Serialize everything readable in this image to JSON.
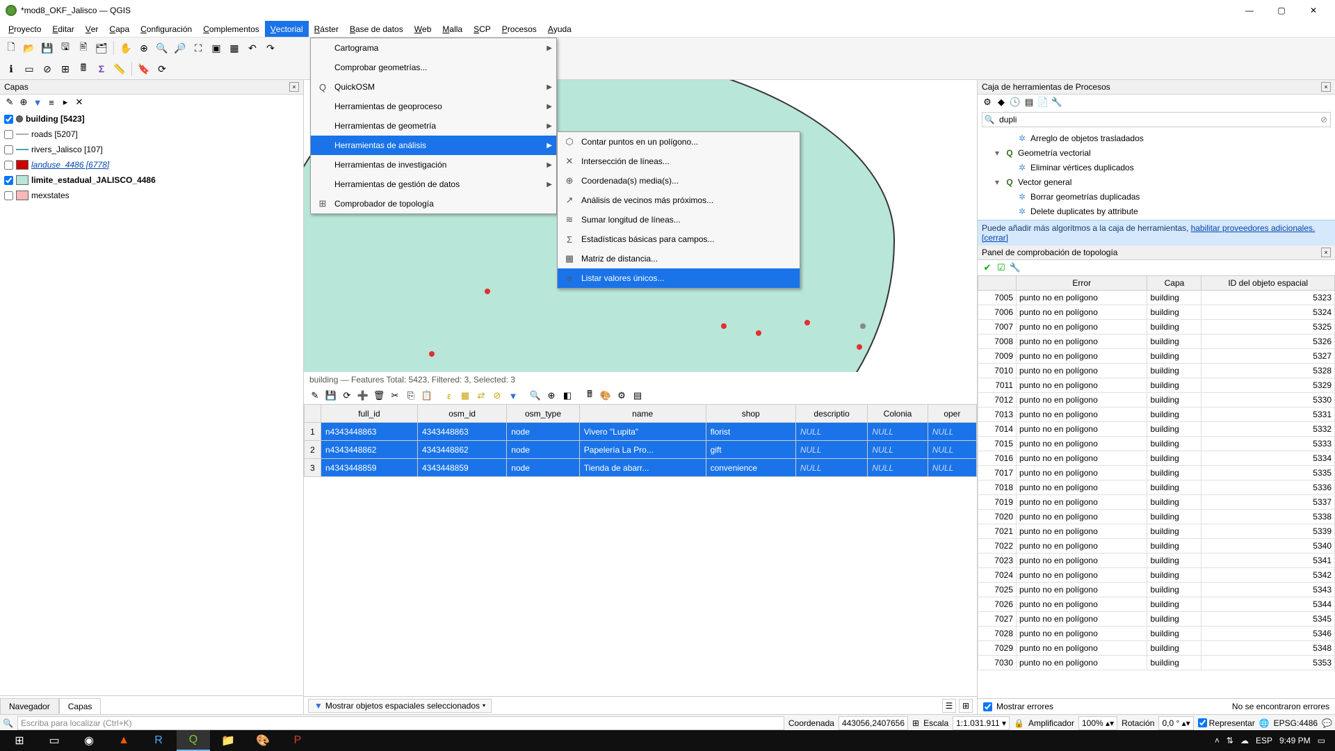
{
  "titlebar": {
    "title": "*mod8_OKF_Jalisco — QGIS"
  },
  "menubar": [
    "Proyecto",
    "Editar",
    "Ver",
    "Capa",
    "Configuración",
    "Complementos",
    "Vectorial",
    "Ráster",
    "Base de datos",
    "Web",
    "Malla",
    "SCP",
    "Procesos",
    "Ayuda"
  ],
  "menubar_active_index": 6,
  "vector_menu": [
    {
      "label": "Cartograma",
      "sub": true,
      "icon": ""
    },
    {
      "label": "Comprobar geometrías...",
      "icon": ""
    },
    {
      "label": "QuickOSM",
      "sub": true,
      "icon": "Q"
    },
    {
      "label": "Herramientas de geoproceso",
      "sub": true,
      "icon": ""
    },
    {
      "label": "Herramientas de geometría",
      "sub": true,
      "icon": ""
    },
    {
      "label": "Herramientas de análisis",
      "sub": true,
      "icon": "",
      "hi": true
    },
    {
      "label": "Herramientas de investigación",
      "sub": true,
      "icon": ""
    },
    {
      "label": "Herramientas de gestión de datos",
      "sub": true,
      "icon": ""
    },
    {
      "label": "Comprobador de topología",
      "icon": "⊞"
    }
  ],
  "analysis_submenu": [
    {
      "label": "Contar puntos en un polígono...",
      "icon": "⬡"
    },
    {
      "label": "Intersección de líneas...",
      "icon": "✕"
    },
    {
      "label": "Coordenada(s) media(s)...",
      "icon": "⊕"
    },
    {
      "label": "Análisis de vecinos más próximos...",
      "icon": "↗"
    },
    {
      "label": "Sumar longitud de líneas...",
      "icon": "≋"
    },
    {
      "label": "Estadísticas básicas para campos...",
      "icon": "Σ"
    },
    {
      "label": "Matriz de distancia...",
      "icon": "▦"
    },
    {
      "label": "Listar valores únicos...",
      "icon": "≡",
      "hi": true
    }
  ],
  "layers_panel": {
    "title": "Capas"
  },
  "layers": [
    {
      "checked": true,
      "visible": true,
      "name": "building [5423]",
      "color": "#666",
      "shape": "pt",
      "bold": true
    },
    {
      "checked": false,
      "name": "roads [5207]",
      "color": "#aaa",
      "shape": "line"
    },
    {
      "checked": false,
      "name": "rivers_Jalisco [107]",
      "color": "#4aa",
      "shape": "line"
    },
    {
      "checked": false,
      "name": "landuse_4486 [6778]",
      "color": "#c00",
      "shape": "poly",
      "link": true
    },
    {
      "checked": true,
      "name": "limite_estadual_JALISCO_4486",
      "color": "#b8e6d9",
      "shape": "poly",
      "bold": true
    },
    {
      "checked": false,
      "name": "mexstates",
      "color": "#f8b8b8",
      "shape": "poly"
    }
  ],
  "left_tabs": [
    "Navegador",
    "Capas"
  ],
  "left_tab_active": 1,
  "attribute_table": {
    "title": "building — Features Total: 5423, Filtered: 3, Selected: 3",
    "columns": [
      "full_id",
      "osm_id",
      "osm_type",
      "name",
      "shop",
      "descriptio",
      "Colonia",
      "oper"
    ],
    "rows": [
      {
        "n": 1,
        "cells": [
          "n4343448863",
          "4343448863",
          "node",
          "Vivero \"Lupita\"",
          "florist",
          "NULL",
          "NULL",
          "NULL"
        ]
      },
      {
        "n": 2,
        "cells": [
          "n4343448862",
          "4343448862",
          "node",
          "Papelería La Pro...",
          "gift",
          "NULL",
          "NULL",
          "NULL"
        ]
      },
      {
        "n": 3,
        "cells": [
          "n4343448859",
          "4343448859",
          "node",
          "Tienda de abarr...",
          "convenience",
          "NULL",
          "NULL",
          "NULL"
        ]
      }
    ]
  },
  "filterbar": {
    "label": "Mostrar objetos espaciales seleccionados"
  },
  "toolbox": {
    "title": "Caja de herramientas de Procesos",
    "search": "dupli",
    "tree": [
      {
        "label": "Arreglo de objetos trasladados",
        "level": 2,
        "icon": "✲"
      },
      {
        "label": "Geometría vectorial",
        "level": 1,
        "icon": "Q",
        "expand": "▾"
      },
      {
        "label": "Eliminar vértices duplicados",
        "level": 2,
        "icon": "✲"
      },
      {
        "label": "Vector general",
        "level": 1,
        "icon": "Q",
        "expand": "▾"
      },
      {
        "label": "Borrar geometrías duplicadas",
        "level": 2,
        "icon": "✲"
      },
      {
        "label": "Delete duplicates by attribute",
        "level": 2,
        "icon": "✲"
      }
    ],
    "tip_a": "Puede añadir más algoritmos a la caja de herramientas,",
    "tip_link1": "habilitar proveedores adicionales.",
    "tip_link2": "[cerrar]"
  },
  "topology_panel": {
    "title": "Panel de comprobación de topología",
    "columns": [
      "Error",
      "Capa",
      "ID del objeto espacial"
    ],
    "rows": [
      [
        7005,
        "punto no en polígono",
        "building",
        5323
      ],
      [
        7006,
        "punto no en polígono",
        "building",
        5324
      ],
      [
        7007,
        "punto no en polígono",
        "building",
        5325
      ],
      [
        7008,
        "punto no en polígono",
        "building",
        5326
      ],
      [
        7009,
        "punto no en polígono",
        "building",
        5327
      ],
      [
        7010,
        "punto no en polígono",
        "building",
        5328
      ],
      [
        7011,
        "punto no en polígono",
        "building",
        5329
      ],
      [
        7012,
        "punto no en polígono",
        "building",
        5330
      ],
      [
        7013,
        "punto no en polígono",
        "building",
        5331
      ],
      [
        7014,
        "punto no en polígono",
        "building",
        5332
      ],
      [
        7015,
        "punto no en polígono",
        "building",
        5333
      ],
      [
        7016,
        "punto no en polígono",
        "building",
        5334
      ],
      [
        7017,
        "punto no en polígono",
        "building",
        5335
      ],
      [
        7018,
        "punto no en polígono",
        "building",
        5336
      ],
      [
        7019,
        "punto no en polígono",
        "building",
        5337
      ],
      [
        7020,
        "punto no en polígono",
        "building",
        5338
      ],
      [
        7021,
        "punto no en polígono",
        "building",
        5339
      ],
      [
        7022,
        "punto no en polígono",
        "building",
        5340
      ],
      [
        7023,
        "punto no en polígono",
        "building",
        5341
      ],
      [
        7024,
        "punto no en polígono",
        "building",
        5342
      ],
      [
        7025,
        "punto no en polígono",
        "building",
        5343
      ],
      [
        7026,
        "punto no en polígono",
        "building",
        5344
      ],
      [
        7027,
        "punto no en polígono",
        "building",
        5345
      ],
      [
        7028,
        "punto no en polígono",
        "building",
        5346
      ],
      [
        7029,
        "punto no en polígono",
        "building",
        5348
      ],
      [
        7030,
        "punto no en polígono",
        "building",
        5353
      ]
    ],
    "show_errors": "Mostrar errores",
    "no_errors": "No se encontraron errores"
  },
  "statusbar": {
    "locator_placeholder": "Escriba para localizar (Ctrl+K)",
    "coord_label": "Coordenada",
    "coord": "443056,2407656",
    "scale_label": "Escala",
    "scale": "1:1.031.911",
    "mag_label": "Amplificador",
    "mag": "100%",
    "rot_label": "Rotación",
    "rot": "0,0 °",
    "render": "Representar",
    "crs": "EPSG:4486"
  },
  "taskbar": {
    "lang": "ESP",
    "time": "9:49 PM"
  }
}
